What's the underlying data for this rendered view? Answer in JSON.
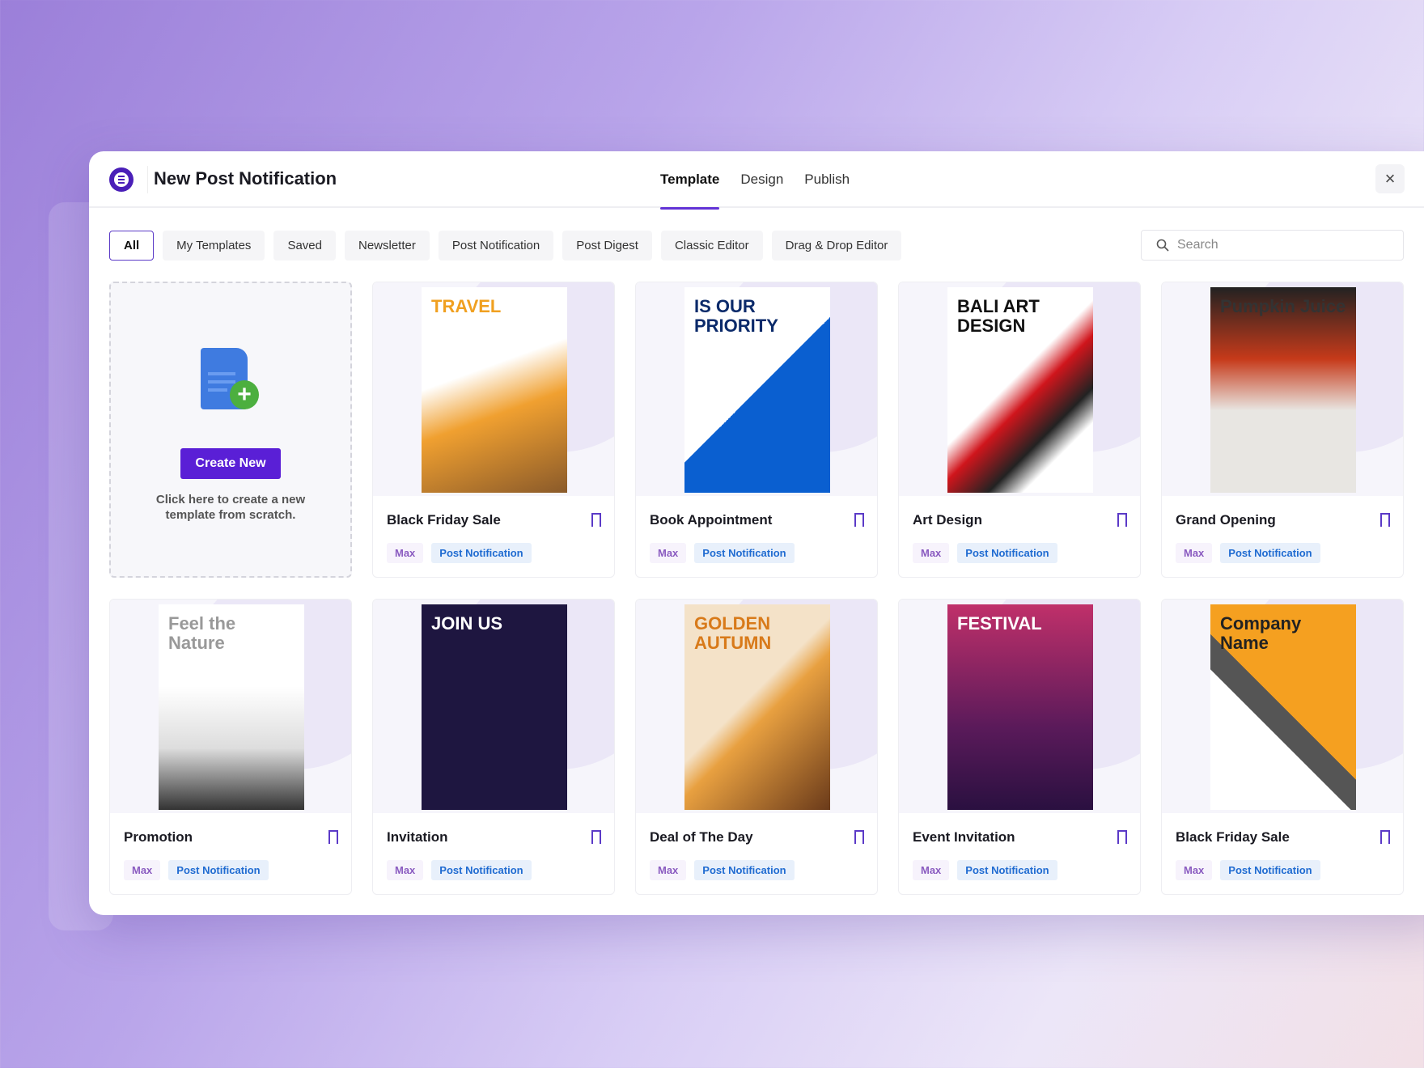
{
  "header": {
    "title": "New Post Notification",
    "tabs": [
      "Template",
      "Design",
      "Publish"
    ],
    "active_tab": "Template",
    "close_icon": "×"
  },
  "filters": [
    "All",
    "My Templates",
    "Saved",
    "Newsletter",
    "Post Notification",
    "Post Digest",
    "Classic Editor",
    "Drag & Drop Editor"
  ],
  "search": {
    "placeholder": "Search"
  },
  "create": {
    "button": "Create New",
    "text": "Click here to create a new template from scratch."
  },
  "cards": [
    {
      "title": "Black Friday Sale",
      "tags": [
        "Max",
        "Post Notification"
      ],
      "poster": "TRAVEL",
      "bg": "linear-gradient(160deg,#fff 40%,#f0a030 60%,#8a5a2a)",
      "fg": "#f0a020"
    },
    {
      "title": "Book Appointment",
      "tags": [
        "Max",
        "Post Notification"
      ],
      "poster": "IS OUR PRIORITY",
      "bg": "linear-gradient(135deg,#fff 50%,#0a5fd0 50%)",
      "fg": "#0b2a6a"
    },
    {
      "title": "Art Design",
      "tags": [
        "Max",
        "Post Notification"
      ],
      "poster": "BALI ART DESIGN",
      "bg": "linear-gradient(135deg,#fff 45%,#d0151c 55%,#222 70%,#fff 80%)",
      "fg": "#111"
    },
    {
      "title": "Grand Opening",
      "tags": [
        "Max",
        "Post Notification"
      ],
      "poster": "Pumpkin Juice",
      "bg": "linear-gradient(180deg,#222 0%,#c63a1a 35%,#e8e6e2 60%)",
      "fg": "#333"
    },
    {
      "title": "Promotion",
      "tags": [
        "Max",
        "Post Notification"
      ],
      "poster": "Feel the Nature",
      "bg": "linear-gradient(180deg,#fff 40%,#ddd 70%,#333)",
      "fg": "#999"
    },
    {
      "title": "Invitation",
      "tags": [
        "Max",
        "Post Notification"
      ],
      "poster": "JOIN US",
      "bg": "#1e1640",
      "fg": "#fff"
    },
    {
      "title": "Deal of The Day",
      "tags": [
        "Max",
        "Post Notification"
      ],
      "poster": "GOLDEN AUTUMN",
      "bg": "linear-gradient(135deg,#f4e2c8 45%,#e8a040 55%,#6a3a1a)",
      "fg": "#d87a1a"
    },
    {
      "title": "Event Invitation",
      "tags": [
        "Max",
        "Post Notification"
      ],
      "poster": "FESTIVAL",
      "bg": "linear-gradient(180deg,#c0306a,#5a1a5a 60%,#2a1040)",
      "fg": "#fff"
    },
    {
      "title": "Black Friday Sale",
      "tags": [
        "Max",
        "Post Notification"
      ],
      "poster": "Company Name",
      "bg": "linear-gradient(225deg,#f5a020 50%,#555 50%,#555 60%,#fff 60%)",
      "fg": "#222"
    }
  ],
  "colors": {
    "accent": "#5a1fd6",
    "tag_max": "#8a5bc0",
    "tag_pn": "#1f6bd1"
  }
}
